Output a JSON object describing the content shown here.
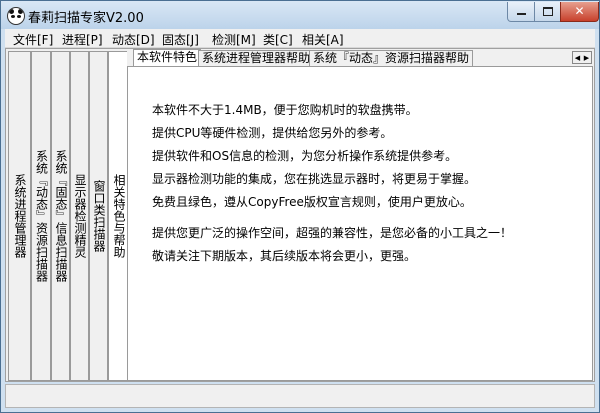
{
  "window": {
    "title": "春莉扫描专家V2.00"
  },
  "menu": [
    "文件[F]",
    "进程[P]",
    "动态[D]",
    "固态[J]",
    "检测[M]",
    "类[C]",
    "相关[A]"
  ],
  "side_tabs": [
    "系统进程管理器",
    "系统『动态』资源扫描器",
    "系统『固态』信息扫描器",
    "显示器检测精灵",
    "窗口类扫描器",
    "相关特色与帮助"
  ],
  "top_tabs": [
    "本软件特色",
    "系统进程管理器帮助",
    "系统『动态』资源扫描器帮助"
  ],
  "content_lines": [
    "本软件不大于1.4MB，便于您购机时的软盘携带。",
    "提供CPU等硬件检测，提供给您另外的参考。",
    "提供软件和OS信息的检测，为您分析操作系统提供参考。",
    "显示器检测功能的集成，您在挑选显示器时，将更易于掌握。",
    "免费且绿色，遵从CopyFree版权宣言规则，使用户更放心。",
    "提供您更广泛的操作空间，超强的兼容性，是您必备的小工具之一！",
    "敬请关注下期版本，其后续版本将会更小，更强。"
  ],
  "colors": {
    "titlebar": "#c4d8ec",
    "close_button": "#c8412c",
    "client_background": "#f0f0f0",
    "content_background": "#ffffff"
  },
  "icons": {
    "app": "panda-icon",
    "tab_scroll": "tab-scroll-arrows-icon"
  }
}
